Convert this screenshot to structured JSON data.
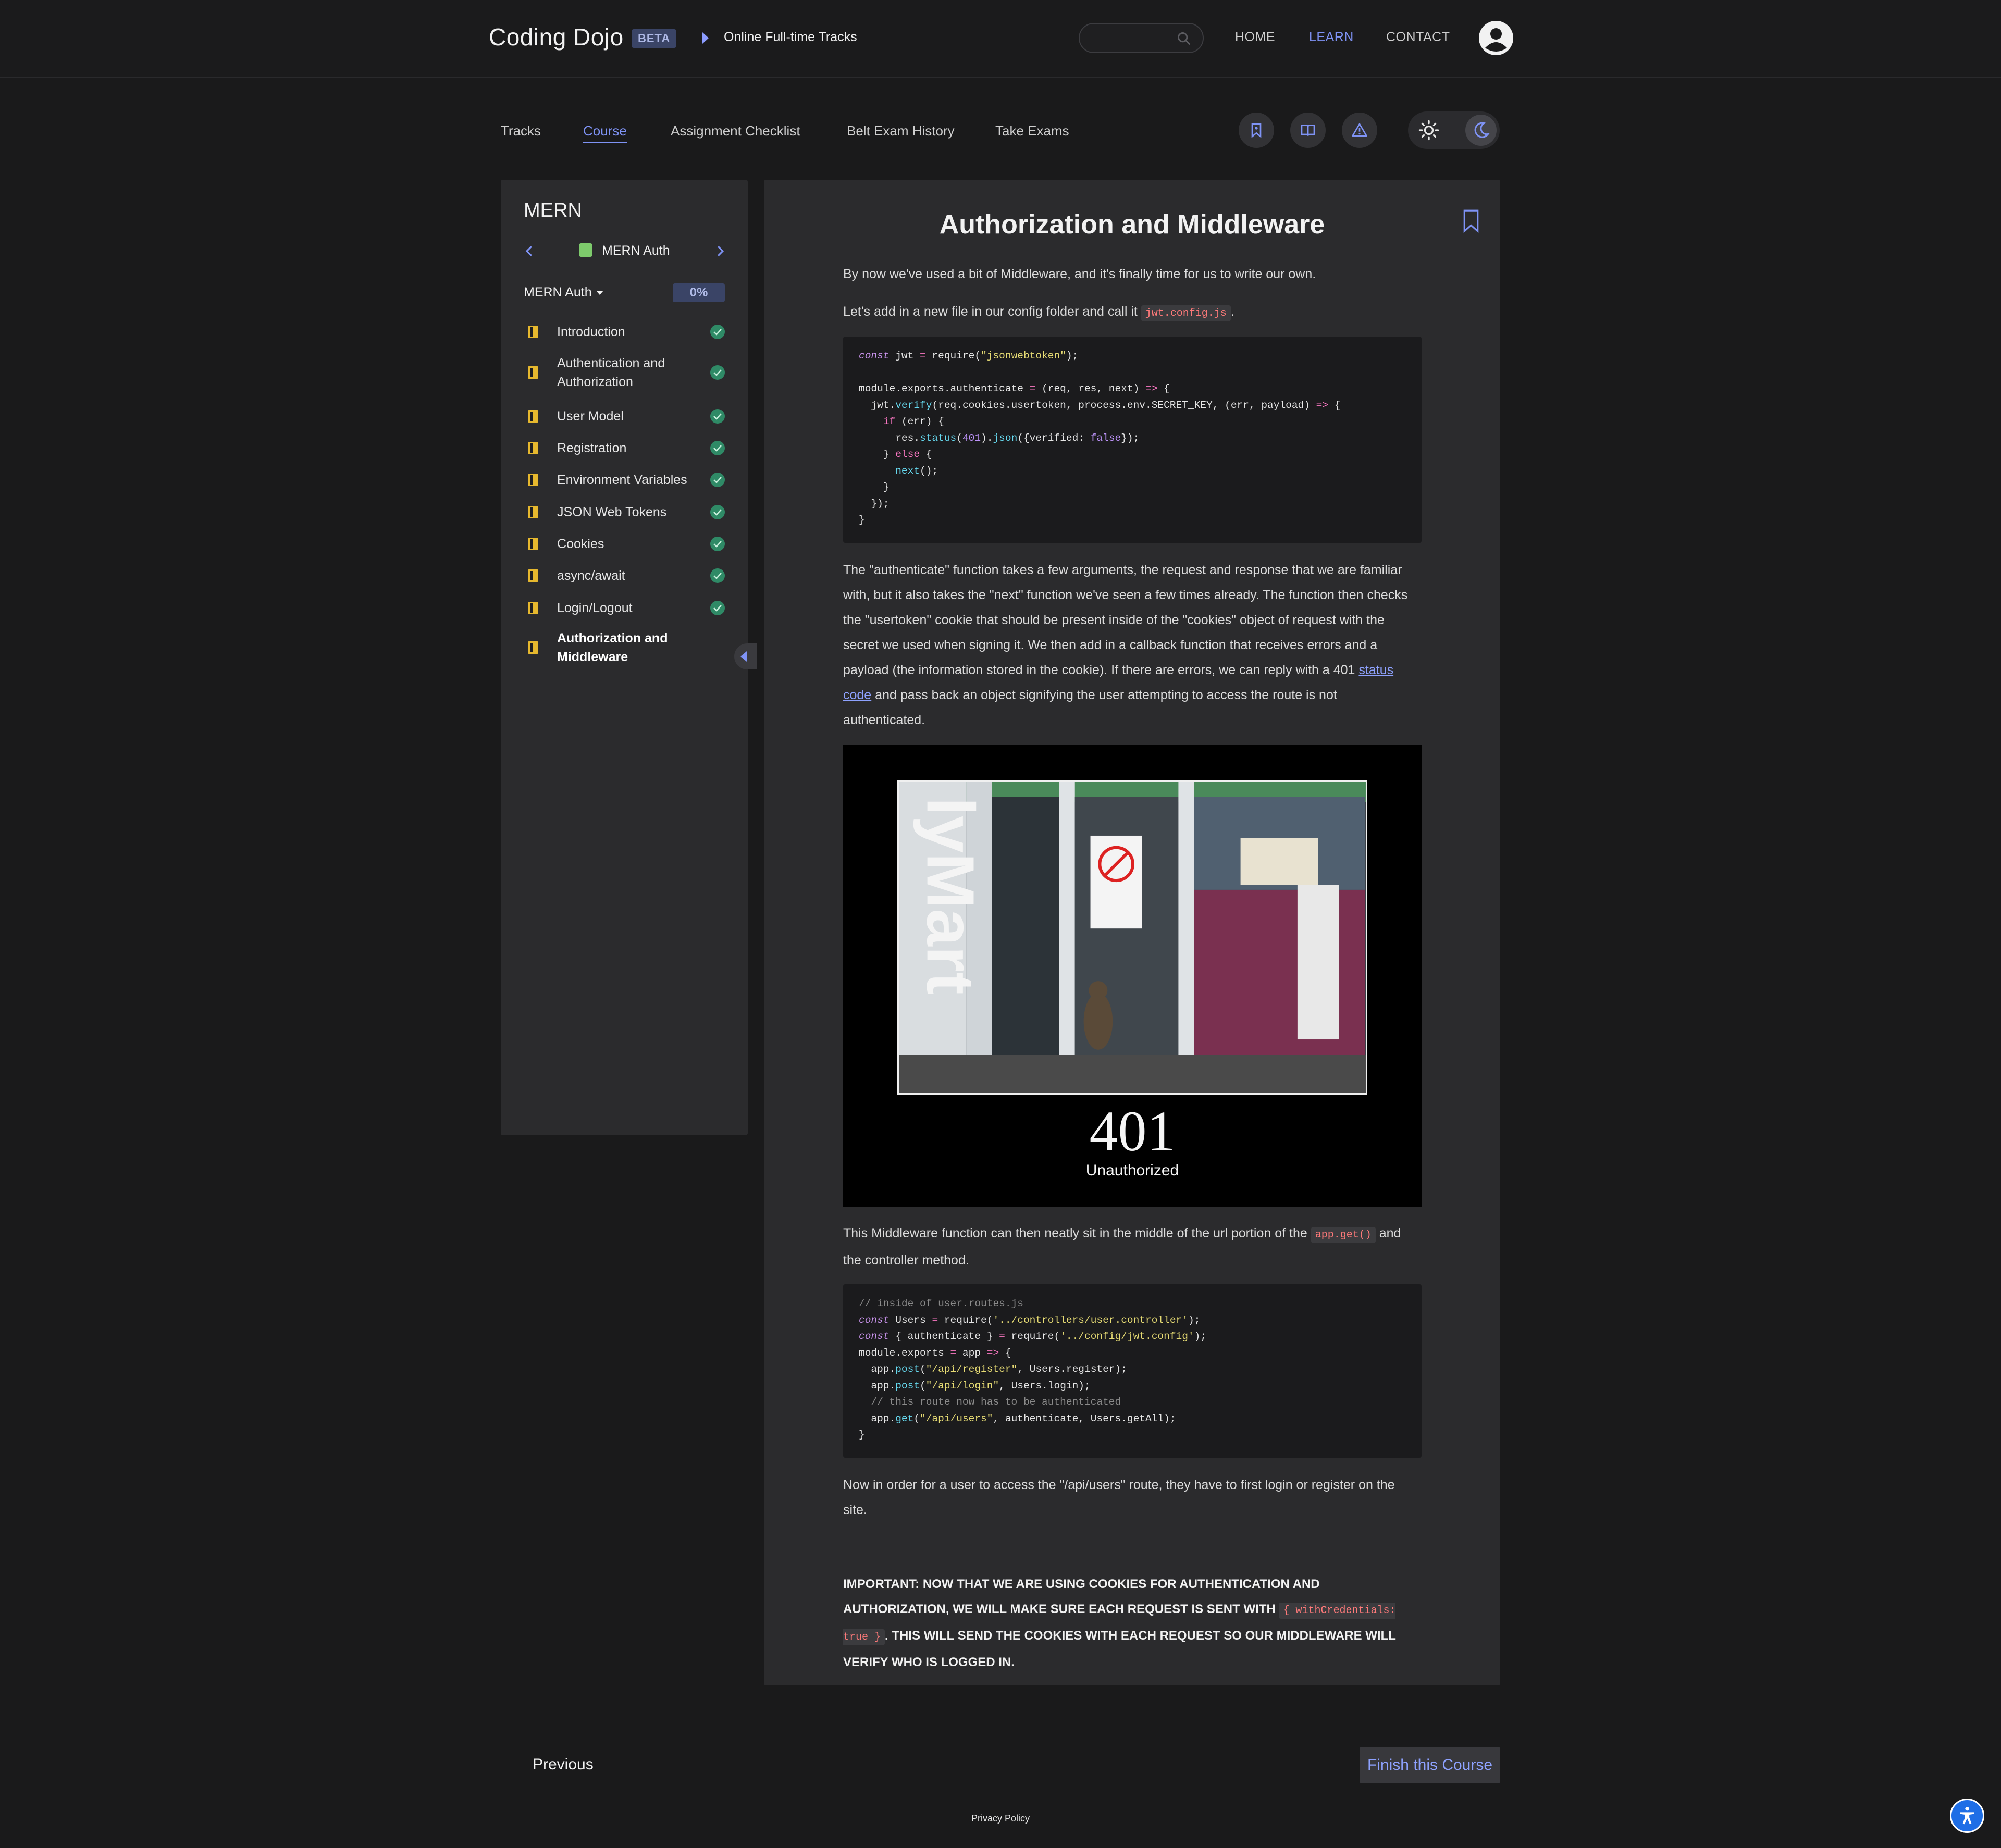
{
  "header": {
    "brand": "Coding Dojo",
    "badge": "BETA",
    "breadcrumb": "Online Full-time Tracks",
    "search_placeholder": "",
    "nav": [
      "HOME",
      "LEARN",
      "CONTACT"
    ],
    "active_nav": "LEARN"
  },
  "tabs": {
    "items": [
      "Tracks",
      "Course",
      "Assignment Checklist",
      "Belt Exam History",
      "Take Exams"
    ],
    "active": "Course"
  },
  "sidebar": {
    "title": "MERN",
    "module": "MERN Auth",
    "dropdown": "MERN Auth",
    "progress": "0%",
    "lessons": [
      {
        "label": "Introduction",
        "done": true
      },
      {
        "label": "Authentication and Authorization",
        "done": true
      },
      {
        "label": "User Model",
        "done": true
      },
      {
        "label": "Registration",
        "done": true
      },
      {
        "label": "Environment Variables",
        "done": true
      },
      {
        "label": "JSON Web Tokens",
        "done": true
      },
      {
        "label": "Cookies",
        "done": true
      },
      {
        "label": "async/await",
        "done": true
      },
      {
        "label": "Login/Logout",
        "done": true
      },
      {
        "label": "Authorization and Middleware",
        "done": false,
        "current": true
      }
    ]
  },
  "content": {
    "title": "Authorization and Middleware",
    "p1": "By now we've used a bit of Middleware, and it's finally time for us to write our own.",
    "p2_before": "Let's add in a new file in our config folder and call it ",
    "p2_code": "jwt.config.js",
    "p2_after": ".",
    "p3_before": "The \"authenticate\" function takes a few arguments, the request and response that we are familiar with, but it also takes the \"next\" function we've seen a few times already. The function then checks the \"usertoken\" cookie that should be present inside of the \"cookies\" object of request with the secret we used when signing it. We then add in a callback function that receives errors and a payload (the information stored in the cookie). If there are errors, we can reply with a 401 ",
    "p3_link": "status code",
    "p3_after": " and pass back an object signifying the user attempting to access the route is not authenticated.",
    "image_code": "401",
    "image_caption": "Unauthorized",
    "image_store_sign": "lyMart",
    "p4_before": "This Middleware function can then neatly sit in the middle of the url portion of the ",
    "p4_code": "app.get()",
    "p4_after": " and the controller method.",
    "p5": "Now in order for a user to access the \"/api/users\" route, they have to first login or register on the site.",
    "important_before": "IMPORTANT: NOW THAT WE ARE USING COOKIES FOR AUTHENTICATION AND AUTHORIZATION, WE WILL MAKE SURE EACH REQUEST IS SENT WITH ",
    "important_code": "{ withCredentials: true }",
    "important_after": ". THIS WILL SEND THE COOKIES WITH EACH REQUEST SO OUR MIDDLEWARE WILL VERIFY WHO IS LOGGED IN."
  },
  "code1": [
    [
      [
        "kw",
        "const"
      ],
      [
        "t",
        " jwt "
      ],
      [
        "op",
        "="
      ],
      [
        "t",
        " require("
      ],
      [
        "str",
        "\"jsonwebtoken\""
      ],
      [
        "t",
        ");"
      ]
    ],
    [],
    [
      [
        "t",
        "module.exports.authenticate "
      ],
      [
        "op",
        "="
      ],
      [
        "t",
        " (req, res, next) "
      ],
      [
        "op",
        "=>"
      ],
      [
        "t",
        " {"
      ]
    ],
    [
      [
        "t",
        "  jwt."
      ],
      [
        "fn",
        "verify"
      ],
      [
        "t",
        "(req.cookies.usertoken, process.env.SECRET_KEY, (err, payload) "
      ],
      [
        "op",
        "=>"
      ],
      [
        "t",
        " {"
      ]
    ],
    [
      [
        "t",
        "    "
      ],
      [
        "kw2",
        "if"
      ],
      [
        "t",
        " (err) {"
      ]
    ],
    [
      [
        "t",
        "      res."
      ],
      [
        "fn",
        "status"
      ],
      [
        "t",
        "("
      ],
      [
        "num",
        "401"
      ],
      [
        "t",
        ")."
      ],
      [
        "fn",
        "json"
      ],
      [
        "t",
        "({verified: "
      ],
      [
        "num",
        "false"
      ],
      [
        "t",
        "});"
      ]
    ],
    [
      [
        "t",
        "    } "
      ],
      [
        "kw2",
        "else"
      ],
      [
        "t",
        " {"
      ]
    ],
    [
      [
        "t",
        "      "
      ],
      [
        "fn",
        "next"
      ],
      [
        "t",
        "();"
      ]
    ],
    [
      [
        "t",
        "    }"
      ]
    ],
    [
      [
        "t",
        "  });"
      ]
    ],
    [
      [
        "t",
        "}"
      ]
    ]
  ],
  "code2": [
    [
      [
        "cmt",
        "// inside of user.routes.js"
      ]
    ],
    [
      [
        "kw",
        "const"
      ],
      [
        "t",
        " Users "
      ],
      [
        "op",
        "="
      ],
      [
        "t",
        " require("
      ],
      [
        "str",
        "'../controllers/user.controller'"
      ],
      [
        "t",
        ");"
      ]
    ],
    [
      [
        "kw",
        "const"
      ],
      [
        "t",
        " { authenticate } "
      ],
      [
        "op",
        "="
      ],
      [
        "t",
        " require("
      ],
      [
        "str",
        "'../config/jwt.config'"
      ],
      [
        "t",
        ");"
      ]
    ],
    [
      [
        "t",
        "module.exports "
      ],
      [
        "op",
        "="
      ],
      [
        "t",
        " app "
      ],
      [
        "op",
        "=>"
      ],
      [
        "t",
        " {"
      ]
    ],
    [
      [
        "t",
        "  app."
      ],
      [
        "fn",
        "post"
      ],
      [
        "t",
        "("
      ],
      [
        "str",
        "\"/api/register\""
      ],
      [
        "t",
        ", Users.register);"
      ]
    ],
    [
      [
        "t",
        "  app."
      ],
      [
        "fn",
        "post"
      ],
      [
        "t",
        "("
      ],
      [
        "str",
        "\"/api/login\""
      ],
      [
        "t",
        ", Users.login);"
      ]
    ],
    [
      [
        "cmt",
        "  // this route now has to be authenticated"
      ]
    ],
    [
      [
        "t",
        "  app."
      ],
      [
        "fn",
        "get"
      ],
      [
        "t",
        "("
      ],
      [
        "str",
        "\"/api/users\""
      ],
      [
        "t",
        ", authenticate, Users.getAll);"
      ]
    ],
    [
      [
        "t",
        "}"
      ]
    ]
  ],
  "footer": {
    "previous": "Previous",
    "finish": "Finish this Course",
    "privacy": "Privacy Policy"
  },
  "colors": {
    "accent": "#7f93f5",
    "background": "#1a1a1b",
    "panel": "#2b2b2d",
    "check": "#2f8a66",
    "book": "#e6b82e"
  }
}
